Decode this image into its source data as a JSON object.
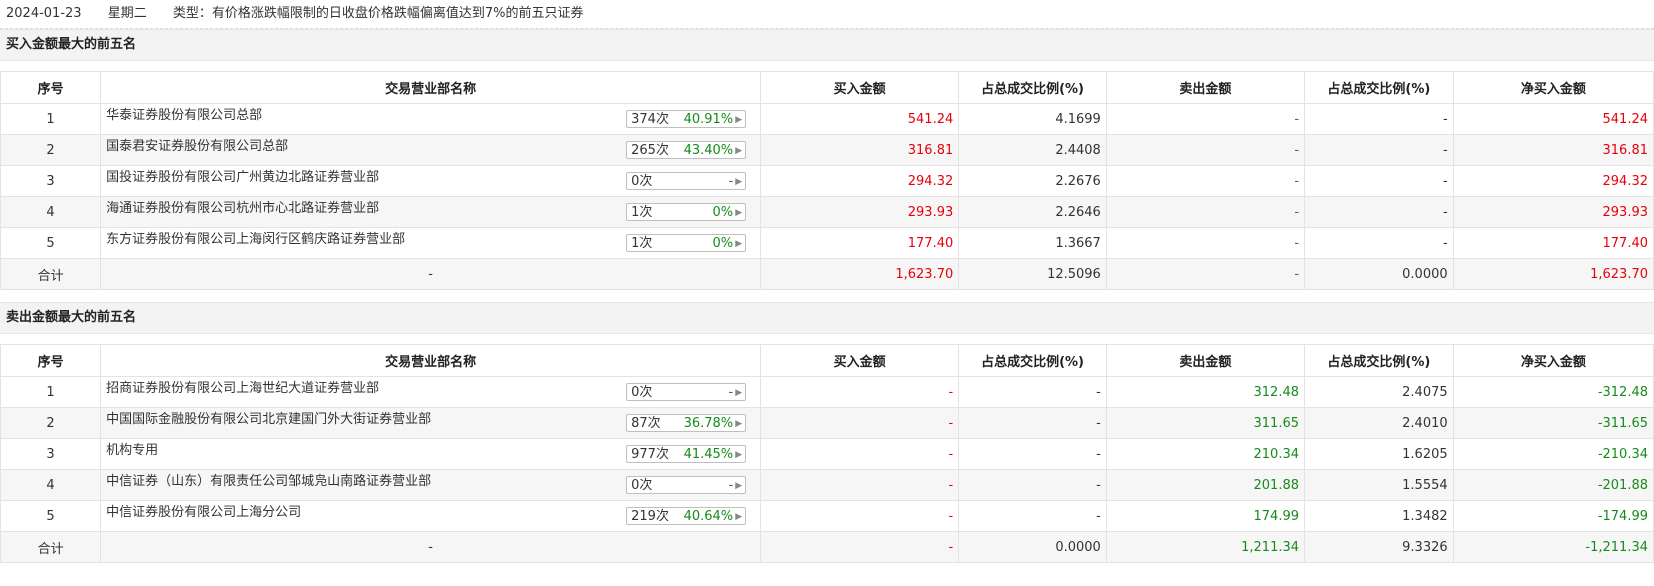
{
  "header": {
    "date": "2024-01-23",
    "weekday": "星期二",
    "type": "类型：有价格涨跌幅限制的日收盘价格跌幅偏离值达到7%的前五只证券"
  },
  "columns": [
    "序号",
    "交易营业部名称",
    "买入金额",
    "占总成交比例(%)",
    "卖出金额",
    "占总成交比例(%)",
    "净买入金额"
  ],
  "buy_section": {
    "title": "买入金额最大的前五名",
    "rows": [
      {
        "idx": "1",
        "name": "华泰证券股份有限公司总部",
        "count": "374次",
        "pct": "40.91%",
        "buy": "541.24",
        "buy_ratio": "4.1699",
        "sell": "-",
        "sell_ratio": "-",
        "net": "541.24"
      },
      {
        "idx": "2",
        "name": "国泰君安证券股份有限公司总部",
        "count": "265次",
        "pct": "43.40%",
        "buy": "316.81",
        "buy_ratio": "2.4408",
        "sell": "-",
        "sell_ratio": "-",
        "net": "316.81"
      },
      {
        "idx": "3",
        "name": "国投证券股份有限公司广州黄边北路证券营业部",
        "count": "0次",
        "pct": "-",
        "buy": "294.32",
        "buy_ratio": "2.2676",
        "sell": "-",
        "sell_ratio": "-",
        "net": "294.32"
      },
      {
        "idx": "4",
        "name": "海通证券股份有限公司杭州市心北路证券营业部",
        "count": "1次",
        "pct": "0%",
        "buy": "293.93",
        "buy_ratio": "2.2646",
        "sell": "-",
        "sell_ratio": "-",
        "net": "293.93"
      },
      {
        "idx": "5",
        "name": "东方证券股份有限公司上海闵行区鹤庆路证券营业部",
        "count": "1次",
        "pct": "0%",
        "buy": "177.40",
        "buy_ratio": "1.3667",
        "sell": "-",
        "sell_ratio": "-",
        "net": "177.40"
      }
    ],
    "total": {
      "label": "合计",
      "name": "-",
      "buy": "1,623.70",
      "buy_ratio": "12.5096",
      "sell": "-",
      "sell_ratio": "0.0000",
      "net": "1,623.70"
    }
  },
  "sell_section": {
    "title": "卖出金额最大的前五名",
    "rows": [
      {
        "idx": "1",
        "name": "招商证券股份有限公司上海世纪大道证券营业部",
        "count": "0次",
        "pct": "-",
        "buy": "-",
        "buy_ratio": "-",
        "sell": "312.48",
        "sell_ratio": "2.4075",
        "net": "-312.48"
      },
      {
        "idx": "2",
        "name": "中国国际金融股份有限公司北京建国门外大街证券营业部",
        "count": "87次",
        "pct": "36.78%",
        "buy": "-",
        "buy_ratio": "-",
        "sell": "311.65",
        "sell_ratio": "2.4010",
        "net": "-311.65"
      },
      {
        "idx": "3",
        "name": "机构专用",
        "count": "977次",
        "pct": "41.45%",
        "buy": "-",
        "buy_ratio": "-",
        "sell": "210.34",
        "sell_ratio": "1.6205",
        "net": "-210.34"
      },
      {
        "idx": "4",
        "name": "中信证券（山东）有限责任公司邹城凫山南路证券营业部",
        "count": "0次",
        "pct": "-",
        "buy": "-",
        "buy_ratio": "-",
        "sell": "201.88",
        "sell_ratio": "1.5554",
        "net": "-201.88"
      },
      {
        "idx": "5",
        "name": "中信证券股份有限公司上海分公司",
        "count": "219次",
        "pct": "40.64%",
        "buy": "-",
        "buy_ratio": "-",
        "sell": "174.99",
        "sell_ratio": "1.3482",
        "net": "-174.99"
      }
    ],
    "total": {
      "label": "合计",
      "name": "-",
      "buy": "-",
      "buy_ratio": "0.0000",
      "sell": "1,211.34",
      "sell_ratio": "9.3326",
      "net": "-1,211.34"
    }
  },
  "colors": {
    "positive": "#e8000b",
    "negative": "#168b1c",
    "header_bg": "#f3f3f3"
  },
  "icons": {
    "expand_arrow": "caret-right-icon"
  }
}
